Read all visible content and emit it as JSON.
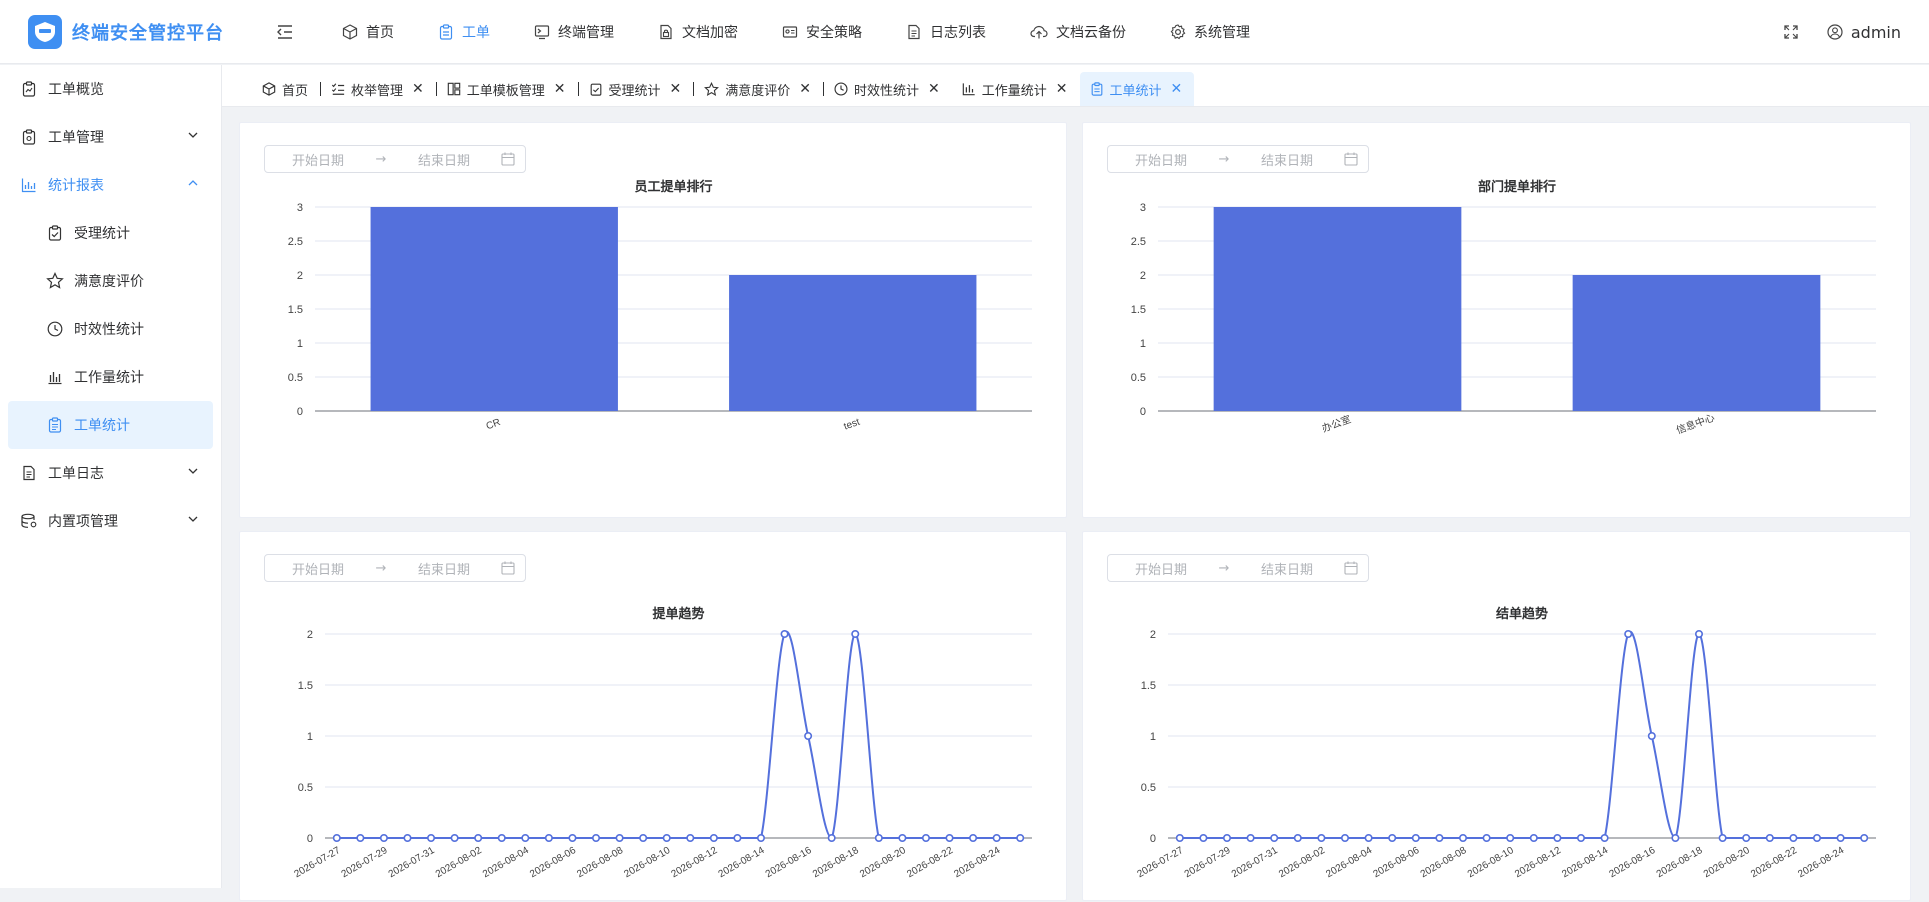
{
  "app": {
    "title": "终端安全管控平台"
  },
  "topnav": [
    {
      "label": "首页",
      "icon": "cube-icon",
      "active": false
    },
    {
      "label": "工单",
      "icon": "clipboard-icon",
      "active": true
    },
    {
      "label": "终端管理",
      "icon": "terminal-icon",
      "active": false
    },
    {
      "label": "文档加密",
      "icon": "doc-lock-icon",
      "active": false
    },
    {
      "label": "安全策略",
      "icon": "id-card-icon",
      "active": false
    },
    {
      "label": "日志列表",
      "icon": "doc-list-icon",
      "active": false
    },
    {
      "label": "文档云备份",
      "icon": "cloud-upload-icon",
      "active": false
    },
    {
      "label": "系统管理",
      "icon": "gear-icon",
      "active": false
    }
  ],
  "user": {
    "name": "admin"
  },
  "sidebar": {
    "items": [
      {
        "label": "工单概览",
        "icon": "overview-icon"
      },
      {
        "label": "工单管理",
        "icon": "clipboard-icon"
      },
      {
        "label": "统计报表",
        "icon": "bar-chart-icon"
      },
      {
        "label": "工单日志",
        "icon": "doc-icon"
      },
      {
        "label": "内置项管理",
        "icon": "database-icon"
      }
    ],
    "subitems": [
      {
        "label": "受理统计",
        "icon": "check-square-icon"
      },
      {
        "label": "满意度评价",
        "icon": "star-icon"
      },
      {
        "label": "时效性统计",
        "icon": "clock-icon"
      },
      {
        "label": "工作量统计",
        "icon": "bar-chart-icon"
      },
      {
        "label": "工单统计",
        "icon": "clipboard-icon"
      }
    ]
  },
  "tabs": [
    {
      "label": "首页",
      "icon": "cube-icon",
      "closable": false,
      "active": false
    },
    {
      "label": "枚举管理",
      "icon": "list-check-icon",
      "closable": true,
      "active": false
    },
    {
      "label": "工单模板管理",
      "icon": "template-icon",
      "closable": true,
      "active": false
    },
    {
      "label": "受理统计",
      "icon": "check-square-icon",
      "closable": true,
      "active": false
    },
    {
      "label": "满意度评价",
      "icon": "star-icon",
      "closable": true,
      "active": false
    },
    {
      "label": "时效性统计",
      "icon": "clock-icon",
      "closable": true,
      "active": false
    },
    {
      "label": "工作量统计",
      "icon": "bar-chart-icon",
      "closable": true,
      "active": false
    },
    {
      "label": "工单统计",
      "icon": "clipboard-icon",
      "closable": true,
      "active": true
    }
  ],
  "daterange": {
    "start_placeholder": "开始日期",
    "end_placeholder": "结束日期",
    "arrow": "→"
  },
  "theme": {
    "accent": "#3f8ff2",
    "bar": "#5470dc",
    "line": "#5470dc"
  },
  "chart_data": [
    {
      "type": "bar",
      "title": "员工提单排行",
      "categories": [
        "CR",
        "test"
      ],
      "values": [
        3,
        2
      ],
      "ylim": [
        0,
        3
      ],
      "yticks": [
        0,
        0.5,
        1,
        1.5,
        2,
        2.5,
        3
      ],
      "grid": true
    },
    {
      "type": "bar",
      "title": "部门提单排行",
      "categories": [
        "办公室",
        "信息中心"
      ],
      "values": [
        3,
        2
      ],
      "ylim": [
        0,
        3
      ],
      "yticks": [
        0,
        0.5,
        1,
        1.5,
        2,
        2.5,
        3
      ],
      "grid": true
    },
    {
      "type": "line",
      "title": "提单趋势",
      "x": [
        "2026-07-27",
        "2026-07-28",
        "2026-07-29",
        "2026-07-30",
        "2026-07-31",
        "2026-08-01",
        "2026-08-02",
        "2026-08-03",
        "2026-08-04",
        "2026-08-05",
        "2026-08-06",
        "2026-08-07",
        "2026-08-08",
        "2026-08-09",
        "2026-08-10",
        "2026-08-11",
        "2026-08-12",
        "2026-08-13",
        "2026-08-14",
        "2026-08-15",
        "2026-08-16",
        "2026-08-17",
        "2026-08-18",
        "2026-08-19",
        "2026-08-20",
        "2026-08-21",
        "2026-08-22",
        "2026-08-23",
        "2026-08-24",
        "2026-08-25"
      ],
      "xtick_labels": [
        "2026-07-27",
        "2026-07-29",
        "2026-07-31",
        "2026-08-02",
        "2026-08-04",
        "2026-08-06",
        "2026-08-08",
        "2026-08-10",
        "2026-08-12",
        "2026-08-14",
        "2026-08-16",
        "2026-08-18",
        "2026-08-20",
        "2026-08-22",
        "2026-08-24"
      ],
      "values": [
        0,
        0,
        0,
        0,
        0,
        0,
        0,
        0,
        0,
        0,
        0,
        0,
        0,
        0,
        0,
        0,
        0,
        0,
        0,
        2,
        1,
        0,
        2,
        0,
        0,
        0,
        0,
        0,
        0,
        0
      ],
      "ylim": [
        0,
        2
      ],
      "yticks": [
        0,
        0.5,
        1,
        1.5,
        2
      ],
      "smooth": true,
      "grid": true
    },
    {
      "type": "line",
      "title": "结单趋势",
      "x": [
        "2026-07-27",
        "2026-07-28",
        "2026-07-29",
        "2026-07-30",
        "2026-07-31",
        "2026-08-01",
        "2026-08-02",
        "2026-08-03",
        "2026-08-04",
        "2026-08-05",
        "2026-08-06",
        "2026-08-07",
        "2026-08-08",
        "2026-08-09",
        "2026-08-10",
        "2026-08-11",
        "2026-08-12",
        "2026-08-13",
        "2026-08-14",
        "2026-08-15",
        "2026-08-16",
        "2026-08-17",
        "2026-08-18",
        "2026-08-19",
        "2026-08-20",
        "2026-08-21",
        "2026-08-22",
        "2026-08-23",
        "2026-08-24",
        "2026-08-25"
      ],
      "xtick_labels": [
        "2026-07-27",
        "2026-07-29",
        "2026-07-31",
        "2026-08-02",
        "2026-08-04",
        "2026-08-06",
        "2026-08-08",
        "2026-08-10",
        "2026-08-12",
        "2026-08-14",
        "2026-08-16",
        "2026-08-18",
        "2026-08-20",
        "2026-08-22",
        "2026-08-24"
      ],
      "values": [
        0,
        0,
        0,
        0,
        0,
        0,
        0,
        0,
        0,
        0,
        0,
        0,
        0,
        0,
        0,
        0,
        0,
        0,
        0,
        2,
        1,
        0,
        2,
        0,
        0,
        0,
        0,
        0,
        0,
        0
      ],
      "ylim": [
        0,
        2
      ],
      "yticks": [
        0,
        0.5,
        1,
        1.5,
        2
      ],
      "smooth": true,
      "grid": true
    }
  ]
}
